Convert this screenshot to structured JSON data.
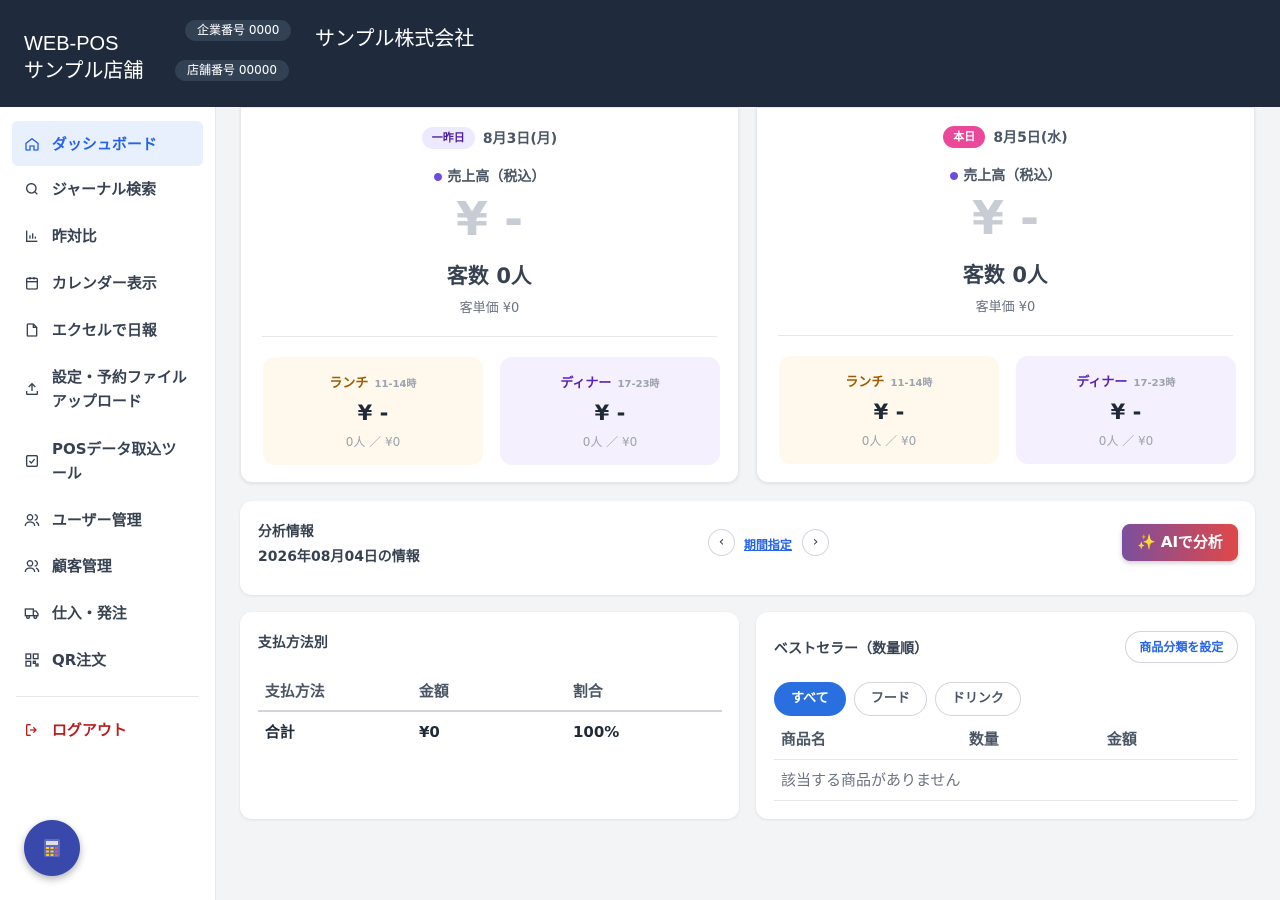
{
  "header": {
    "brand_line1": "WEB-POS",
    "brand_line2": "サンプル店舗",
    "company_no": "企業番号 0000",
    "store_no": "店舗番号 00000",
    "company_name": "サンプル株式会社"
  },
  "sidebar": {
    "items": [
      {
        "label": "ダッシュボード",
        "icon": "home-icon"
      },
      {
        "label": "ジャーナル検索",
        "icon": "search-icon"
      },
      {
        "label": "昨対比",
        "icon": "bar-chart-icon"
      },
      {
        "label": "カレンダー表示",
        "icon": "calendar-icon"
      },
      {
        "label": "エクセルで日報",
        "icon": "file-icon"
      },
      {
        "label": "設定・予約ファイルアップロード",
        "icon": "upload-icon"
      },
      {
        "label": "POSデータ取込ツール",
        "icon": "check-square-icon"
      },
      {
        "label": "ユーザー管理",
        "icon": "users-icon"
      },
      {
        "label": "顧客管理",
        "icon": "users-icon"
      },
      {
        "label": "仕入・発注",
        "icon": "truck-icon"
      },
      {
        "label": "QR注文",
        "icon": "qr-code-icon"
      }
    ],
    "logout": "ログアウト",
    "fab_icon": "calculator-icon",
    "active_color": "#2563eb"
  },
  "days": [
    {
      "badge": "一昨日",
      "date": "8月3日(月)",
      "sales_label": "売上高（税込）",
      "sales_value": "¥ -",
      "customers": "客数 0人",
      "unit_price": "客単価 ¥0",
      "lunch": {
        "title": "ランチ",
        "hours": "11-14時",
        "value": "¥ -",
        "sub": "0人 ／ ¥0"
      },
      "dinner": {
        "title": "ディナー",
        "hours": "17-23時",
        "value": "¥ -",
        "sub": "0人 ／ ¥0"
      }
    },
    {
      "badge": "本日",
      "date": "8月5日(水)",
      "sales_label": "売上高（税込）",
      "sales_value": "¥ -",
      "customers": "客数 0人",
      "unit_price": "客単価 ¥0",
      "lunch": {
        "title": "ランチ",
        "hours": "11-14時",
        "value": "¥ -",
        "sub": "0人 ／ ¥0"
      },
      "dinner": {
        "title": "ディナー",
        "hours": "17-23時",
        "value": "¥ -",
        "sub": "0人 ／ ¥0"
      }
    }
  ],
  "analysis": {
    "title": "分析情報",
    "date_info": "2026年08月04日の情報",
    "prev": "‹",
    "next": "›",
    "period_link": "期間指定",
    "ai_button": "✨ AIで分析"
  },
  "payment": {
    "title": "支払方法別",
    "headers": [
      "支払方法",
      "金額",
      "割合"
    ],
    "rows": [
      [
        "合計",
        "¥0",
        "100%"
      ]
    ]
  },
  "bestseller": {
    "title": "ベストセラー（数量順）",
    "category_button": "商品分類を設定",
    "filters": [
      "すべて",
      "フード",
      "ドリンク"
    ],
    "headers": [
      "商品名",
      "数量",
      "金額"
    ],
    "empty": "該当する商品がありません"
  }
}
